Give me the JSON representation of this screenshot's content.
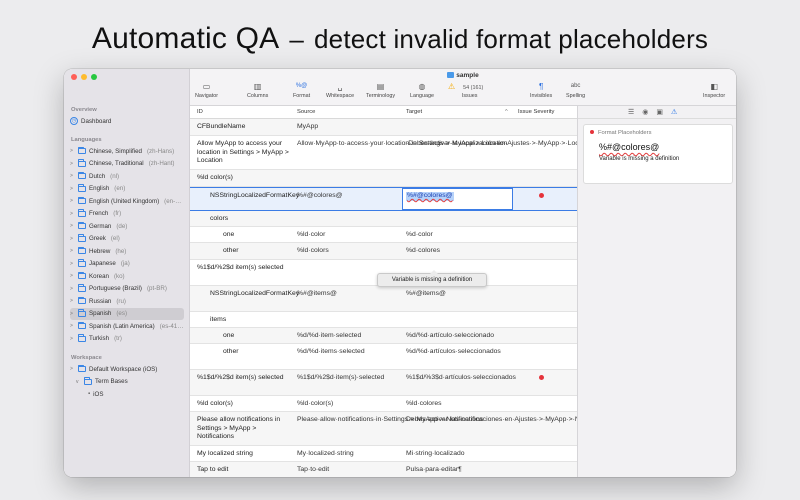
{
  "headline": {
    "title": "Automatic QA",
    "dash": "–",
    "subtitle": "detect invalid format placeholders"
  },
  "window": {
    "title": "sample"
  },
  "toolbar": {
    "buttons": [
      {
        "label": "Navigator",
        "icon": "sidebar-icon"
      },
      {
        "label": "Columns",
        "icon": "columns-icon"
      },
      {
        "label": "Format",
        "icon": "format-icon",
        "glyph": "%@"
      },
      {
        "label": "Whitespace",
        "icon": "whitespace-icon"
      },
      {
        "label": "Terminology",
        "icon": "terminology-icon"
      },
      {
        "label": "Language",
        "icon": "globe-icon"
      },
      {
        "label": "Issues",
        "icon": "warning-icon",
        "count": "54 (161)"
      },
      {
        "label": "Invisibles",
        "icon": "pilcrow-icon"
      },
      {
        "label": "Spelling",
        "icon": "spelling-icon",
        "glyph": "abc"
      },
      {
        "label": "Inspector",
        "icon": "inspector-icon"
      }
    ]
  },
  "sidebar": {
    "overview_label": "Overview",
    "dashboard_label": "Dashboard",
    "languages_label": "Languages",
    "languages": [
      {
        "name": "Chinese, Simplified",
        "code": "(zh-Hans)"
      },
      {
        "name": "Chinese, Traditional",
        "code": "(zh-Hant)"
      },
      {
        "name": "Dutch",
        "code": "(nl)"
      },
      {
        "name": "English",
        "code": "(en)"
      },
      {
        "name": "English (United Kingdom)",
        "code": "(en-…"
      },
      {
        "name": "French",
        "code": "(fr)"
      },
      {
        "name": "German",
        "code": "(de)"
      },
      {
        "name": "Greek",
        "code": "(el)"
      },
      {
        "name": "Hebrew",
        "code": "(he)"
      },
      {
        "name": "Japanese",
        "code": "(ja)"
      },
      {
        "name": "Korean",
        "code": "(ko)"
      },
      {
        "name": "Portuguese (Brazil)",
        "code": "(pt-BR)"
      },
      {
        "name": "Russian",
        "code": "(ru)"
      },
      {
        "name": "Spanish",
        "code": "(es)"
      },
      {
        "name": "Spanish (Latin America)",
        "code": "(es-41…"
      },
      {
        "name": "Turkish",
        "code": "(tr)"
      }
    ],
    "workspace_label": "Workspace",
    "workspace": [
      {
        "name": "Default Workspace (iOS)"
      },
      {
        "name": "Term Bases"
      },
      {
        "name": "iOS"
      }
    ]
  },
  "grid": {
    "headers": {
      "id": "ID",
      "source": "Source",
      "target": "Target",
      "issue": "Issue Severity"
    },
    "rows": [
      {
        "id": "CFBundleName",
        "source": "MyApp",
        "target": ""
      },
      {
        "id": "Allow MyApp to access your location in Settings > MyApp > Location",
        "source": "Allow·MyApp·to·access·your·location·in·Settings·>·MyApp·>·Location",
        "target": "·Debes·activar·la·localización·en·Ajustes·>·MyApp·>·Localización"
      },
      {
        "id": "%ld color(s)",
        "source": "",
        "target": ""
      },
      {
        "id": "NSStringLocalizedFormatKey",
        "source": "%#@colores@",
        "target": "%#@colores@"
      },
      {
        "id": "colors",
        "source": "",
        "target": ""
      },
      {
        "id": "one",
        "source": "%ld·color",
        "target": "%d·color"
      },
      {
        "id": "other",
        "source": "%ld·colors",
        "target": "%d·colores"
      },
      {
        "id": "%1$d/%2$d item(s) selected",
        "source": "",
        "target": ""
      },
      {
        "id": "NSStringLocalizedFormatKey",
        "source": "%#@items@",
        "target": "%#@items@"
      },
      {
        "id": "items",
        "source": "",
        "target": ""
      },
      {
        "id": "one",
        "source": "%d/%d·item·selected",
        "target": "%d/%d·artículo·seleccionado"
      },
      {
        "id": "other",
        "source": "%d/%d·items·selected",
        "target": "%d/%d·artículos·seleccionados"
      },
      {
        "id": "%1$d/%2$d item(s) selected",
        "source": "%1$d/%2$d·item(s)·selected",
        "target": "%1$d/%3$d·artículos·seleccionados"
      },
      {
        "id": "%ld color(s)",
        "source": "%ld·color(s)",
        "target": "%ld·colores"
      },
      {
        "id": "Please allow notifications in Settings > MyApp > Notifications",
        "source": "Please·allow·notifications·in·Settings·>·MyApp·>·Notifications",
        "target": "Debes·activar·las·notificaciones·en·Ajustes·>·MyApp·>·Notificaciones"
      },
      {
        "id": "My localized string",
        "source": "My·localized·string",
        "target": "Mi·string·localizado"
      },
      {
        "id": "Tap to edit",
        "source": "Tap·to·edit",
        "target": "Pulsa·para·editar¶"
      }
    ],
    "tooltip": "Variable is missing a definition"
  },
  "inspector": {
    "section": "Format Placeholders",
    "value": "%#@colores@",
    "message": "Variable is missing a definition"
  }
}
